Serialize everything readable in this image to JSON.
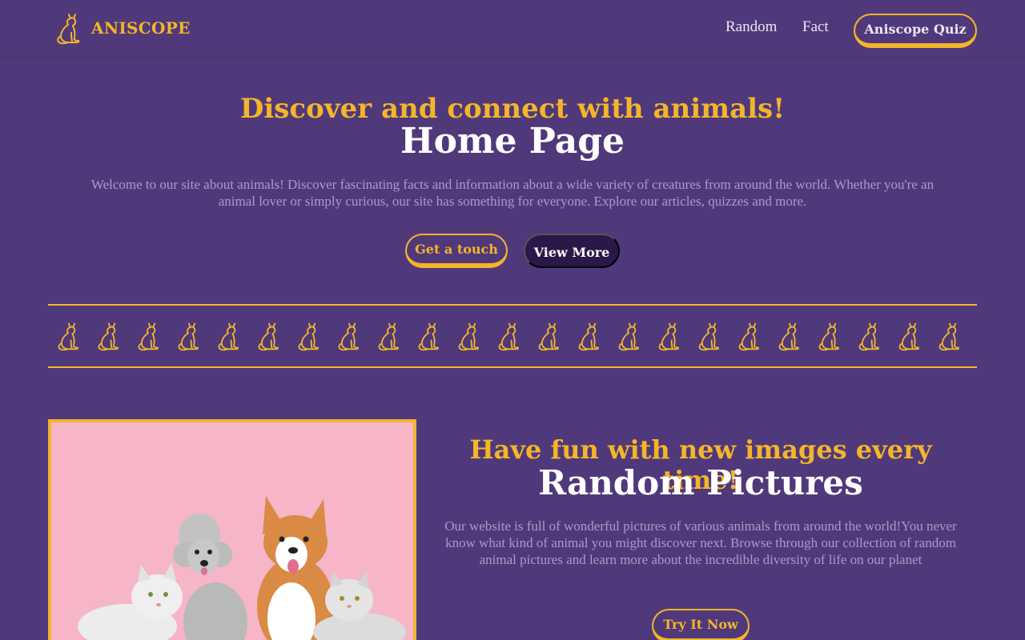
{
  "nav": {
    "brand": "ANISCOPE",
    "brand_icon": "cat-logo-icon",
    "links": [
      "Random",
      "Fact"
    ],
    "quiz_button": "Aniscope Quiz"
  },
  "hero": {
    "tagline": "Discover and connect with animals!",
    "title": "Home Page",
    "description": "Welcome to our site about animals! Discover fascinating facts and information about a wide variety of creatures from around the world. Whether you're an animal lover or simply curious, our site has something for everyone. Explore our articles, quizzes and more.",
    "primary_button": "Get a touch",
    "secondary_button": "View More"
  },
  "icon_strip": {
    "icon": "cat-icon",
    "count": 23
  },
  "random_section": {
    "image_icon": "pets-photo",
    "tagline": "Have fun with new images every time!",
    "title": "Random Pictures",
    "description": "Our website is full of wonderful pictures of various animals from around the world!You never know what kind of animal you might discover next. Browse through our collection of random animal pictures and learn more about the incredible diversity of life on our planet",
    "button": "Try It Now"
  },
  "colors": {
    "background": "#50397a",
    "accent": "#f3b52a",
    "dark_button": "#2a1848",
    "muted_text": "#a99bc8",
    "photo_background": "#f6b6c8"
  }
}
